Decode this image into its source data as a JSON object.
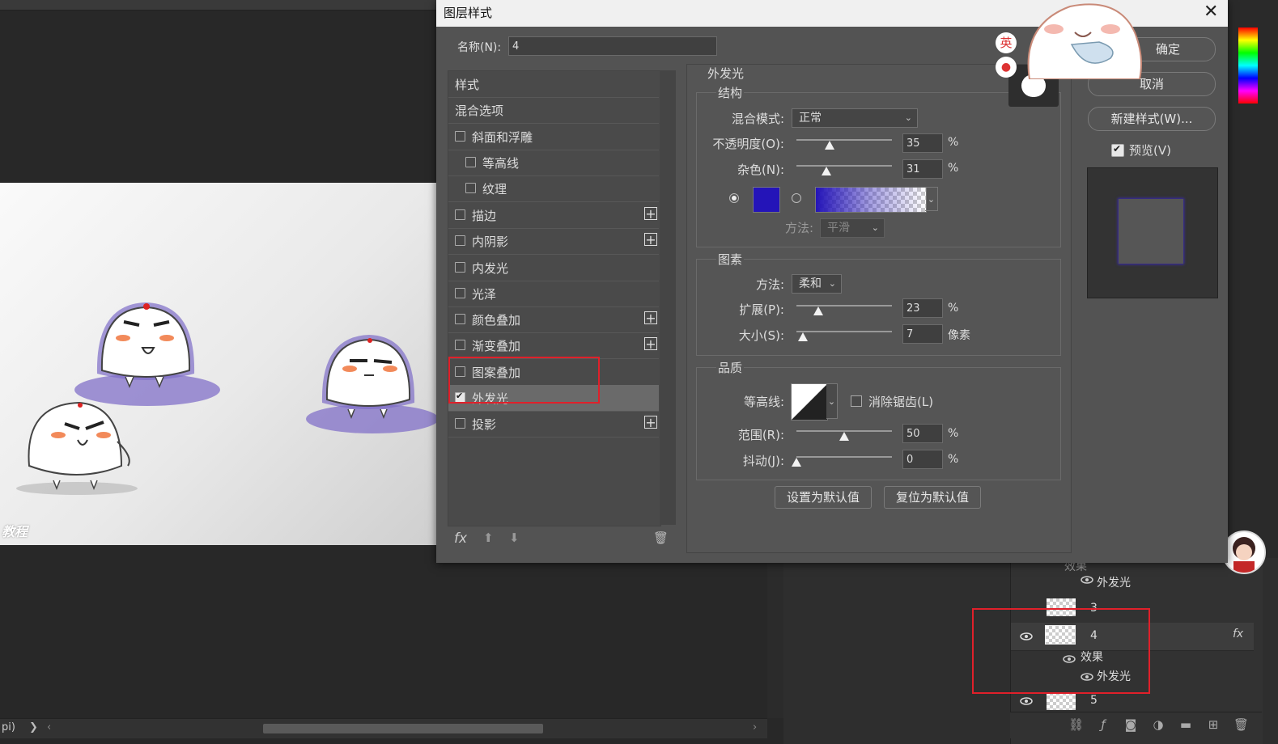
{
  "dialog": {
    "title": "图层样式",
    "name_label": "名称(N):",
    "name_value": "4",
    "close": "✕",
    "buttons": {
      "ok": "确定",
      "cancel": "取消",
      "new_style": "新建样式(W)...",
      "preview": "预览(V)"
    }
  },
  "style_list": {
    "header": "样式",
    "blend": "混合选项",
    "items": [
      {
        "label": "斜面和浮雕"
      },
      {
        "label": "等高线"
      },
      {
        "label": "纹理"
      },
      {
        "label": "描边"
      },
      {
        "label": "内阴影"
      },
      {
        "label": "内发光"
      },
      {
        "label": "光泽"
      },
      {
        "label": "颜色叠加"
      },
      {
        "label": "渐变叠加"
      },
      {
        "label": "图案叠加"
      },
      {
        "label": "外发光"
      },
      {
        "label": "投影"
      }
    ],
    "fx": "fx"
  },
  "outer_glow": {
    "title": "外发光",
    "structure": {
      "label": "结构",
      "blend_mode_label": "混合模式:",
      "blend_mode": "正常",
      "opacity_label": "不透明度(O):",
      "opacity": "35",
      "noise_label": "杂色(N):",
      "noise": "31",
      "percent": "%",
      "method_label": "方法:",
      "method": "平滑",
      "color": "#2414b8"
    },
    "elements": {
      "label": "图素",
      "technique_label": "方法:",
      "technique": "柔和",
      "spread_label": "扩展(P):",
      "spread": "23",
      "size_label": "大小(S):",
      "size": "7",
      "px_unit": "像素"
    },
    "quality": {
      "label": "品质",
      "contour_label": "等高线:",
      "antialias_label": "消除锯齿(L)",
      "range_label": "范围(R):",
      "range": "50",
      "jitter_label": "抖动(J):",
      "jitter": "0"
    },
    "set_default": "设置为默认值",
    "reset_default": "复位为默认值"
  },
  "levels": {
    "opacity": 0.35,
    "noise": 0.31,
    "spread": 0.23,
    "size": 0.07,
    "range": 0.5,
    "jitter": 0
  },
  "layers": {
    "effects": "效果",
    "outer_glow": "外发光",
    "layer3": "3",
    "layer4": "4",
    "layer5": "5",
    "effects2": "效果",
    "outer_glow2": "外发光",
    "fx": "fx"
  },
  "canvas": {
    "watermark": "教程"
  },
  "status": {
    "text": "pi)"
  },
  "ime": {
    "lang": "英"
  },
  "colors": {
    "annotation": "#e0202a",
    "glow": "#2414b8"
  }
}
